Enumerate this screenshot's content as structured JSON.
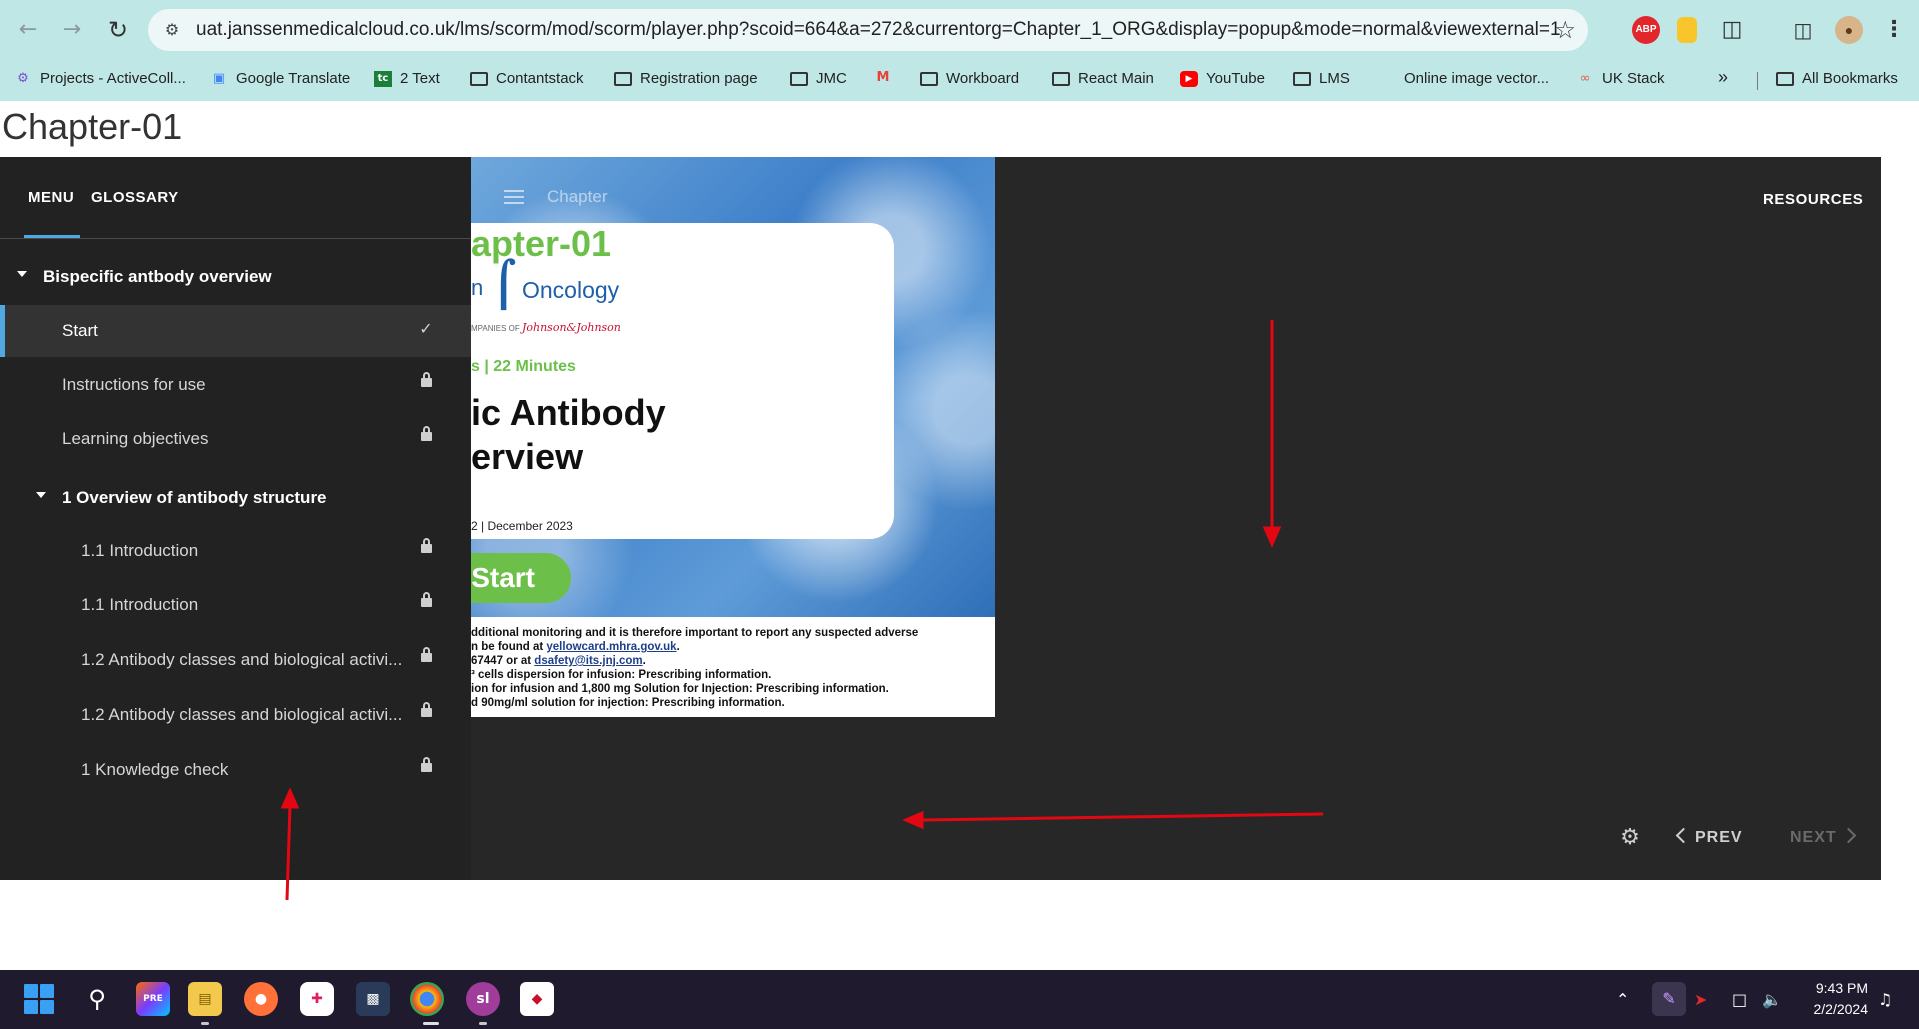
{
  "browser": {
    "url": "uat.janssenmedicalcloud.co.uk/lms/scorm/mod/scorm/player.php?scoid=664&a=272&currentorg=Chapter_1_ORG&display=popup&mode=normal&viewexternal=1",
    "extension_abp": "ABP",
    "bookmarks": [
      "Projects - ActiveColl...",
      "Google Translate",
      "2 Text",
      "Contantstack",
      "Registration page",
      "JMC",
      "Workboard",
      "React Main",
      "YouTube",
      "LMS",
      "Online image vector...",
      "UK Stack",
      "All Bookmarks"
    ],
    "bookmark_tc_icon": "tc"
  },
  "page": {
    "title": "Chapter-01"
  },
  "player": {
    "tabs": {
      "menu": "MENU",
      "glossary": "GLOSSARY"
    },
    "resources": "RESOURCES",
    "menu": {
      "section_title": "Bispecific antbody overview",
      "items": [
        {
          "label": "Start",
          "status": "complete"
        },
        {
          "label": "Instructions for use",
          "status": "locked"
        },
        {
          "label": "Learning objectives",
          "status": "locked"
        }
      ],
      "subsection_title": "1 Overview of antibody structure",
      "subitems": [
        {
          "label": "1.1 Introduction",
          "status": "locked"
        },
        {
          "label": "1.1 Introduction",
          "status": "locked"
        },
        {
          "label": "1.2 Antibody classes and biological activi...",
          "status": "locked"
        },
        {
          "label": "1.2 Antibody classes and biological activi...",
          "status": "locked"
        },
        {
          "label": "1 Knowledge check",
          "status": "locked"
        }
      ]
    },
    "slide": {
      "header_label": "Chapter",
      "title": "apter-01",
      "logo_partial": "n",
      "logo_word": "Oncology",
      "companies": "MPANIES OF",
      "companies_brand": "Johnson&Johnson",
      "duration": "s | 22 Minutes",
      "heading": "ic Antibody\nerview",
      "date": "2 | December 2023",
      "start_label": "Start",
      "footer_lines": [
        {
          "text": "dditional monitoring and it is therefore important to report any suspected adverse",
          "link": ""
        },
        {
          "text": "n be found at ",
          "link": "yellowcard.mhra.gov.uk",
          "after": "."
        },
        {
          "text": "67447 or at ",
          "link": "dsafety@its.jnj.com",
          "after": "."
        },
        {
          "text": "³ cells dispersion for infusion: Prescribing information.",
          "link": ""
        },
        {
          "text": "ion for infusion and 1,800 mg Solution for Injection: Prescribing information.",
          "link": ""
        },
        {
          "text": "d 90mg/ml solution for injection: Prescribing information.",
          "link": ""
        }
      ]
    },
    "controls": {
      "prev": "PREV",
      "next": "NEXT"
    },
    "accent_color": "#4fa8e0"
  },
  "taskbar": {
    "slack_label": "sl",
    "time": "9:43 PM",
    "date": "2/2/2024"
  },
  "colors": {
    "browser_bar": "#bfe7e6",
    "player_bg": "#272727",
    "sidebar_bg": "#222222",
    "slide_green": "#6cc04a",
    "annotation_red": "#e30613"
  }
}
